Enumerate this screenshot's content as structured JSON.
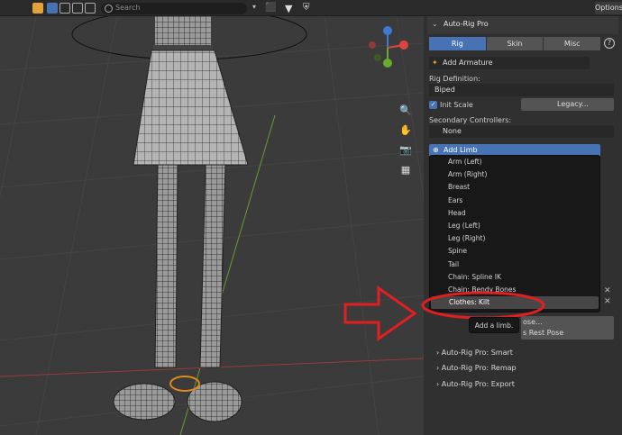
{
  "header": {
    "search_placeholder": "Search",
    "options_label": "Options"
  },
  "panel": {
    "title": "Auto-Rig Pro",
    "tabs": [
      {
        "label": "Rig"
      },
      {
        "label": "Skin"
      },
      {
        "label": "Misc"
      }
    ],
    "active_tab": "Rig",
    "add_armature": "Add Armature",
    "rig_definition_label": "Rig Definition:",
    "rig_definition_value": "Biped",
    "init_scale_label": "Init Scale",
    "init_scale_checked": true,
    "legacy_button": "Legacy...",
    "secondary_controllers_label": "Secondary Controllers:",
    "secondary_controllers_value": "None",
    "add_limb_label": "Add Limb",
    "partial_button_1": "ose...",
    "partial_button_2": "s Rest Pose",
    "sections": [
      {
        "label": "Auto-Rig Pro: Smart"
      },
      {
        "label": "Auto-Rig Pro: Remap"
      },
      {
        "label": "Auto-Rig Pro: Export"
      }
    ]
  },
  "limb_menu": {
    "items": [
      {
        "label": "Arm (Left)"
      },
      {
        "label": "Arm (Right)"
      },
      {
        "label": "Breast"
      },
      {
        "label": "Ears"
      },
      {
        "label": "Head"
      },
      {
        "label": "Leg (Left)"
      },
      {
        "label": "Leg (Right)"
      },
      {
        "label": "Spine"
      },
      {
        "label": "Tail"
      },
      {
        "label": "Chain: Spline IK"
      },
      {
        "label": "Chain: Bendy Bones"
      },
      {
        "label": "Clothes: Kilt"
      }
    ],
    "highlighted": "Clothes: Kilt",
    "tooltip": "Add a limb."
  },
  "colors": {
    "accent": "#4772b3",
    "annotation_red": "#e02020",
    "gizmo_x": "#e04141",
    "gizmo_y": "#6aab2e",
    "gizmo_z": "#3c7ad6"
  }
}
